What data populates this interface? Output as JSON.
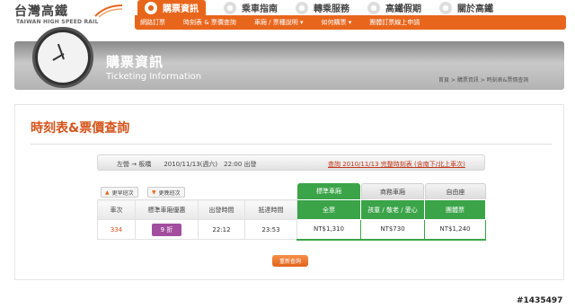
{
  "logo": {
    "cn": "台灣高鐵",
    "en": "TAIWAN HIGH SPEED RAIL"
  },
  "main_nav": [
    {
      "label": "購票資訊",
      "icon": "ticket-icon"
    },
    {
      "label": "乘車指南",
      "icon": "guide-icon"
    },
    {
      "label": "轉乘服務",
      "icon": "transfer-icon"
    },
    {
      "label": "高鐵假期",
      "icon": "holiday-icon"
    },
    {
      "label": "關於高鐵",
      "icon": "info-icon"
    }
  ],
  "sub_nav": [
    {
      "label": "網路訂票"
    },
    {
      "label": "時刻表 & 票價查詢"
    },
    {
      "label": "車廂 / 票種說明 ▾"
    },
    {
      "label": "如何購票 ▾"
    },
    {
      "label": "團體訂票線上申請"
    }
  ],
  "banner": {
    "title": "購票資訊",
    "subtitle": "Ticketing Information",
    "breadcrumb": "首頁 > 購票資訊 > 時刻表&票價查詢"
  },
  "page_title": "時刻表&票價查詢",
  "route": {
    "summary": "左營 → 板橋　　2010/11/13(週六)　22:00 出發",
    "link": "查詢 2010/11/13 完整時刻表 (含南下/北上車次)"
  },
  "sort": {
    "earlier": "更早班次",
    "later": "更晚班次"
  },
  "tabs": [
    "標準車廂",
    "商務車廂",
    "自由座"
  ],
  "table": {
    "headers": [
      "車次",
      "標準車廂優惠",
      "出發時間",
      "抵達時間"
    ],
    "fare_headers": [
      "全票",
      "孩童 / 敬老 / 愛心",
      "團體票"
    ],
    "rows": [
      {
        "train": "334",
        "discount": "9 折",
        "depart": "22:12",
        "arrive": "23:53",
        "full": "NT$1,310",
        "concession": "NT$730",
        "group": "NT$1,240"
      }
    ]
  },
  "requery_label": "重新查詢",
  "watermark": "#1435497",
  "colors": {
    "accent": "#e8661c",
    "green": "#3ba449",
    "discount": "#a24d9e",
    "title": "#d4531b"
  }
}
